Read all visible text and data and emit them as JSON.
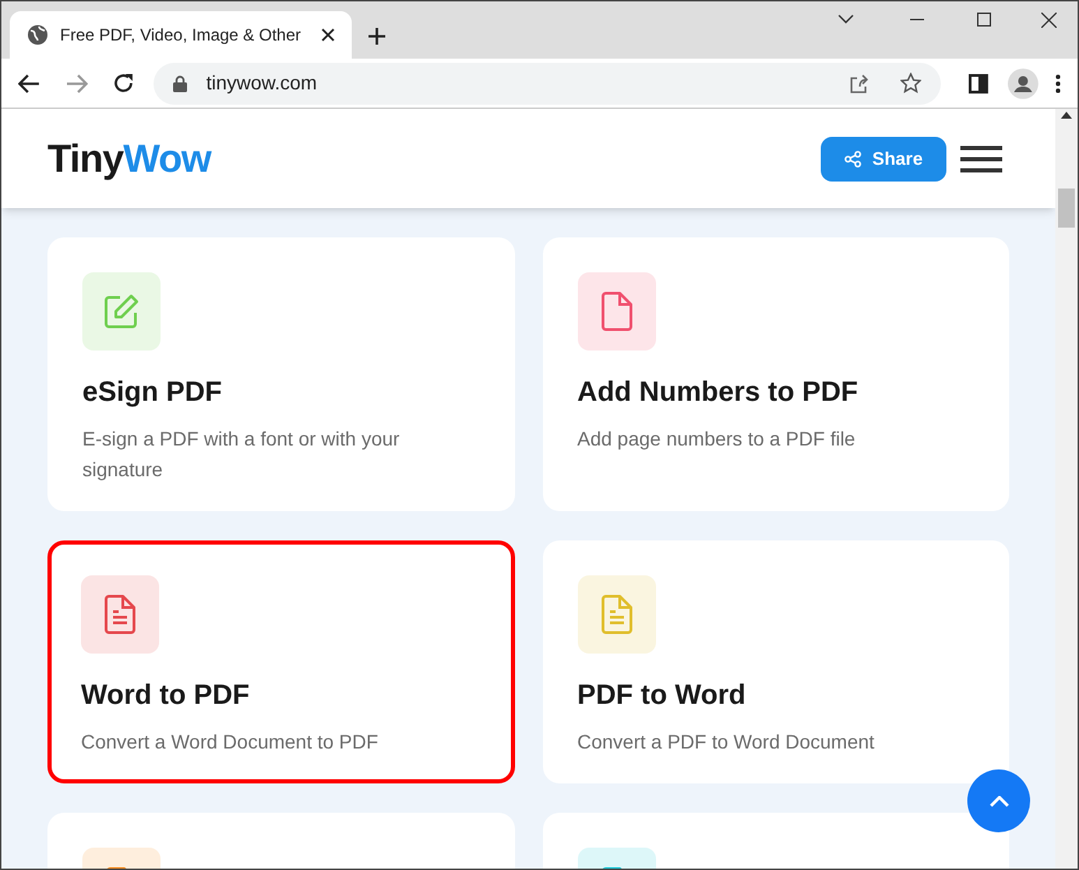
{
  "browser": {
    "tab_title": "Free PDF, Video, Image & Other",
    "address": "tinywow.com"
  },
  "header": {
    "logo": [
      {
        "text": "Tiny",
        "kind": "dark"
      },
      {
        "text": "Wow",
        "kind": "blue"
      }
    ],
    "share_label": "Share"
  },
  "cards": [
    {
      "kind": "edit",
      "color": "#6fcf4f",
      "title": "eSign PDF",
      "description": "E-sign a PDF with a font or with your signature",
      "highlighted": false
    },
    {
      "kind": "file",
      "color": "#f0506e",
      "title": "Add Numbers to PDF",
      "description": "Add page numbers to a PDF file",
      "highlighted": false
    },
    {
      "kind": "doc",
      "color": "#e5484d",
      "title": "Word to PDF",
      "description": "Convert a Word Document to PDF",
      "highlighted": true
    },
    {
      "kind": "doc",
      "color": "#e0be2c",
      "title": "PDF to Word",
      "description": "Convert a PDF to Word Document",
      "highlighted": false
    },
    {
      "kind": "file",
      "color": "#f78a1d",
      "highlighted": false
    },
    {
      "kind": "file",
      "color": "#1cc8d8",
      "highlighted": false
    }
  ]
}
